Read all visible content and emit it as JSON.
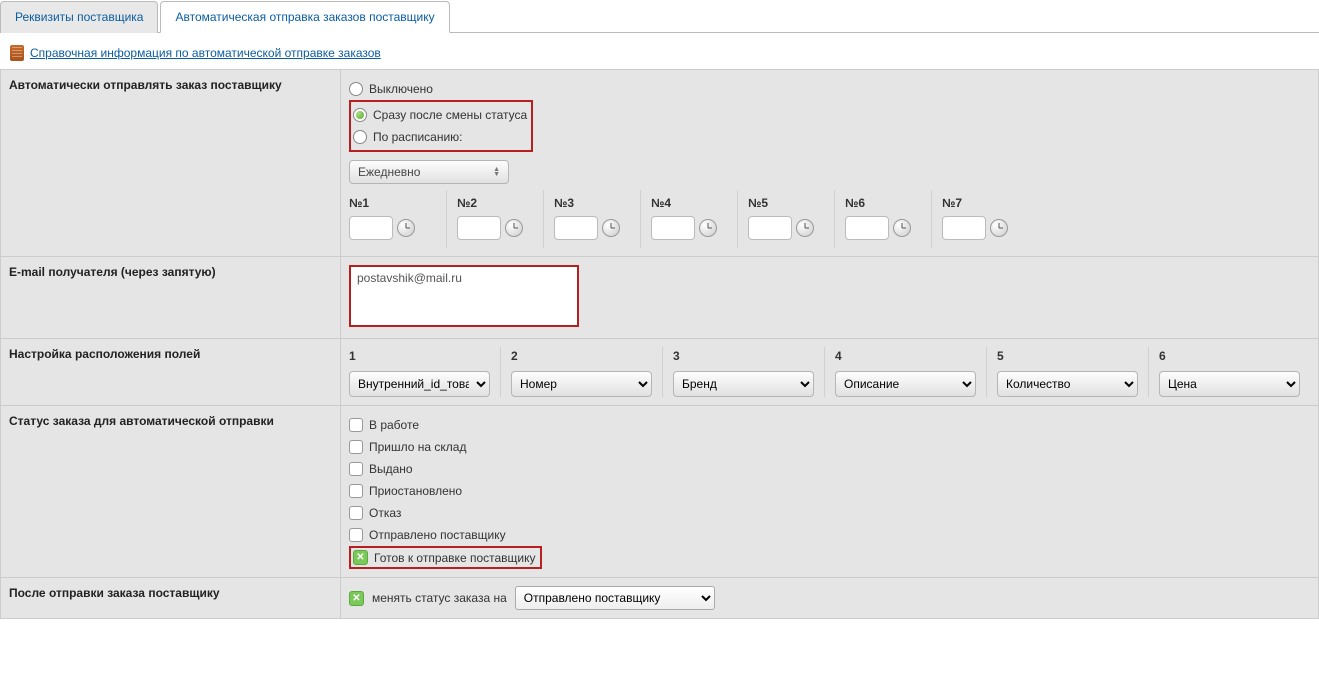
{
  "tabs": {
    "supplier_details": "Реквизиты поставщика",
    "auto_send": "Автоматическая отправка заказов поставщику"
  },
  "help_link": "Справочная информация по автоматической отправке заказов",
  "rows": {
    "auto_send_label": "Автоматически отправлять заказ поставщику",
    "email_label": "E-mail получателя (через запятую)",
    "fields_label": "Настройка расположения полей",
    "status_label": "Статус заказа для автоматической отправки",
    "after_send_label": "После отправки заказа поставщику"
  },
  "auto_send_options": {
    "off": "Выключено",
    "immediately": "Сразу после смены статуса",
    "scheduled": "По расписанию:"
  },
  "schedule_select": "Ежедневно",
  "time_headers": [
    "№1",
    "№2",
    "№3",
    "№4",
    "№5",
    "№6",
    "№7"
  ],
  "email_value": "postavshik@mail.ru",
  "field_cols": [
    {
      "hdr": "1",
      "val": "Внутренний_id_товар"
    },
    {
      "hdr": "2",
      "val": "Номер"
    },
    {
      "hdr": "3",
      "val": "Бренд"
    },
    {
      "hdr": "4",
      "val": "Описание"
    },
    {
      "hdr": "5",
      "val": "Количество"
    },
    {
      "hdr": "6",
      "val": "Цена"
    }
  ],
  "statuses": [
    "В работе",
    "Пришло на склад",
    "Выдано",
    "Приостановлено",
    "Отказ",
    "Отправлено поставщику",
    "Готов к отправке поставщику"
  ],
  "after_send": {
    "checkbox_label": "менять статус заказа на",
    "select_value": "Отправлено поставщику"
  }
}
